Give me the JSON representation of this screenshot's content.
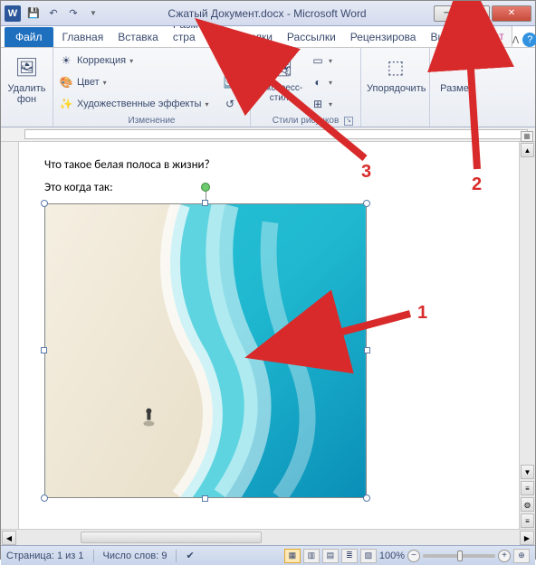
{
  "titlebar": {
    "app_icon": "W",
    "title": "Сжатый Документ.docx - Microsoft Word"
  },
  "tabs": {
    "file": "Файл",
    "items": [
      "Главная",
      "Вставка",
      "Разметка стра",
      "Ссылки",
      "Рассылки",
      "Рецензирова",
      "Вид",
      "Формат"
    ]
  },
  "ribbon": {
    "remove_bg": "Удалить фон",
    "correction": "Коррекция",
    "color": "Цвет",
    "artistic": "Художественные эффекты",
    "group_change": "Изменение",
    "express_styles": "Экспресс-стили",
    "group_styles": "Стили рисунков",
    "arrange": "Упорядочить",
    "size": "Разме"
  },
  "document": {
    "line1": "Что такое белая полоса в жизни?",
    "line2": "Это когда так:"
  },
  "statusbar": {
    "page": "Страница: 1 из 1",
    "words": "Число слов: 9",
    "zoom": "100%"
  },
  "annotations": {
    "a1": "1",
    "a2": "2",
    "a3": "3"
  }
}
